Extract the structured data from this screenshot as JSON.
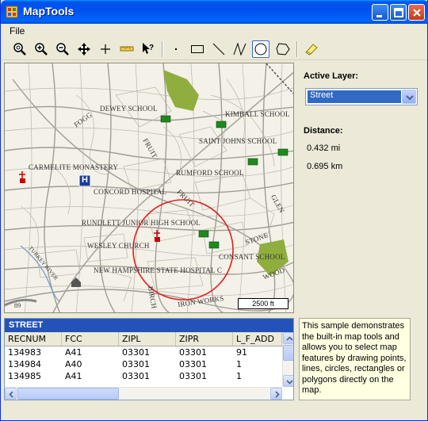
{
  "window": {
    "title": "MapTools"
  },
  "menu": {
    "file": "File"
  },
  "toolbar": {
    "tools": [
      "zoom-full-icon",
      "zoom-in-icon",
      "zoom-out-icon",
      "pan-icon",
      "center-icon",
      "measure-icon",
      "info-icon",
      "point-icon",
      "rectangle-icon",
      "line-icon",
      "polyline-icon",
      "circle-icon",
      "polygon-icon",
      "eraser-icon"
    ],
    "selected": "circle-icon"
  },
  "map": {
    "labels": {
      "dewey": "DEWEY SCHOOL",
      "kimball": "KIMBALL SCHOOL",
      "saint_johns": "SAINT JOHNS SCHOOL",
      "carmelite": "CARMELITE MONASTERY",
      "rumford": "RUMFORD SCHOOL",
      "concord": "CONCORD HOSPITAL",
      "rundlett": "RUNDLETT JUNIOR HIGH SCHOOL",
      "wesley": "WESLEY CHURCH",
      "consant": "CONSANT SCHOOL",
      "nh_state": "NEW HAMPSHIRE STATE HOSPITAL C",
      "stone": "STONE",
      "wood": "WOOD",
      "iron_works": "IRON WORKS",
      "birch": "BIRCH",
      "fruit1": "FRUIT",
      "fruit2": "FRUIT",
      "glen": "GLEN",
      "fogg": "FOGG",
      "turkey_river": "TURKEY RIVER",
      "route": "89",
      "hospital_h": "H"
    },
    "scale": "2500 ft"
  },
  "side": {
    "active_layer_label": "Active Layer:",
    "active_layer_value": "Street",
    "distance_label": "Distance:",
    "distance_mi": "0.432 mi",
    "distance_km": "0.695 km"
  },
  "grid": {
    "caption": "STREET",
    "columns": [
      "RECNUM",
      "FCC",
      "ZIPL",
      "ZIPR",
      "L_F_ADD"
    ],
    "rows": [
      [
        "134983",
        "A41",
        "03301",
        "03301",
        "91"
      ],
      [
        "134984",
        "A40",
        "03301",
        "03301",
        "1"
      ],
      [
        "134985",
        "A41",
        "03301",
        "03301",
        "1"
      ]
    ]
  },
  "description": "This sample demonstrates the built-in map tools and allows you to select map features by drawing points, lines, circles, rectangles or polygons directly on the map.",
  "colors": {
    "title_bar": "#0054e3",
    "grid_caption": "#2453b8",
    "selection_circle": "#e02020",
    "park": "#8fae3e"
  }
}
